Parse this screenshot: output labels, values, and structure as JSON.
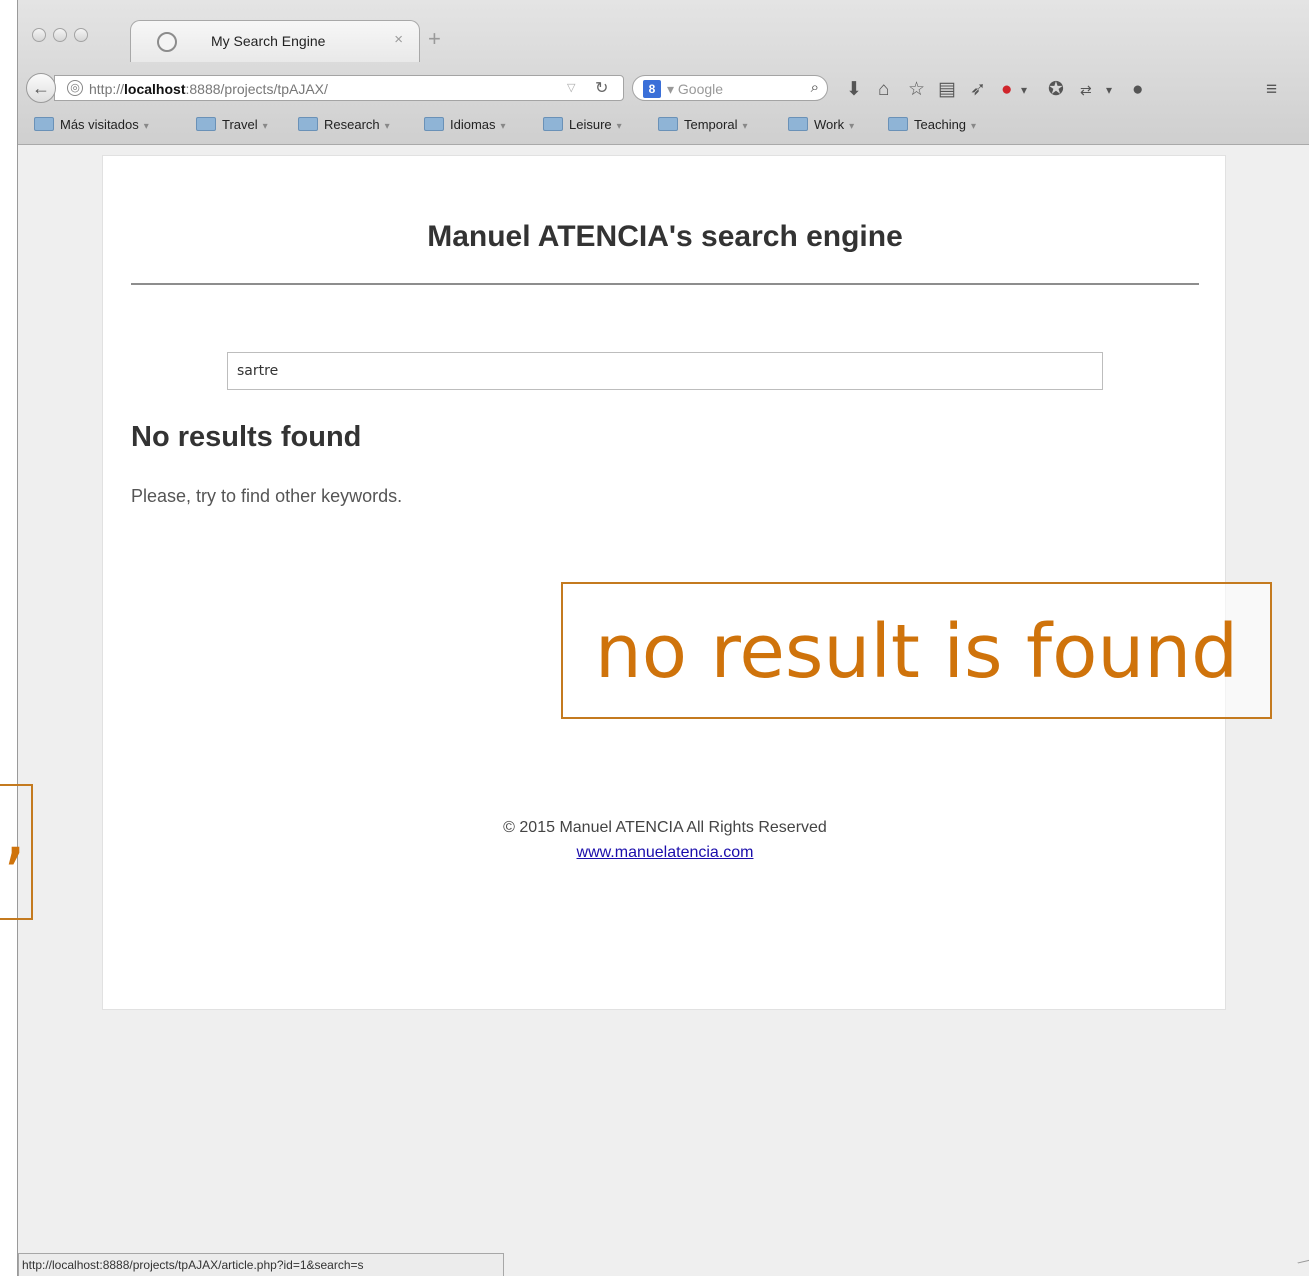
{
  "browser": {
    "tab_title": "My Search Engine",
    "tab_close": "×",
    "new_tab": "+",
    "back_glyph": "←",
    "url_prefix": "http://",
    "url_host": "localhost",
    "url_rest": ":8888/projects/tpAJAX/",
    "search_engine_badge": "8",
    "search_engine_placeholder": "Google",
    "status_url": "http://localhost:8888/projects/tpAJAX/article.php?id=1&search=s"
  },
  "bookmarks": [
    {
      "label": "Más visitados"
    },
    {
      "label": "Travel"
    },
    {
      "label": "Research"
    },
    {
      "label": "Idiomas"
    },
    {
      "label": "Leisure"
    },
    {
      "label": "Temporal"
    },
    {
      "label": "Work"
    },
    {
      "label": "Teaching"
    }
  ],
  "page": {
    "site_title": "Manuel ATENCIA's search engine",
    "search_value": "sartre",
    "no_results_heading": "No results found",
    "no_results_message": "Please, try to find other keywords.",
    "copyright": "© 2015 Manuel ATENCIA All Rights Reserved",
    "site_link": "www.manuelatencia.com"
  },
  "annotation": {
    "text": "no result is found",
    "left_fragment": ",",
    "color": "#cf730b"
  }
}
